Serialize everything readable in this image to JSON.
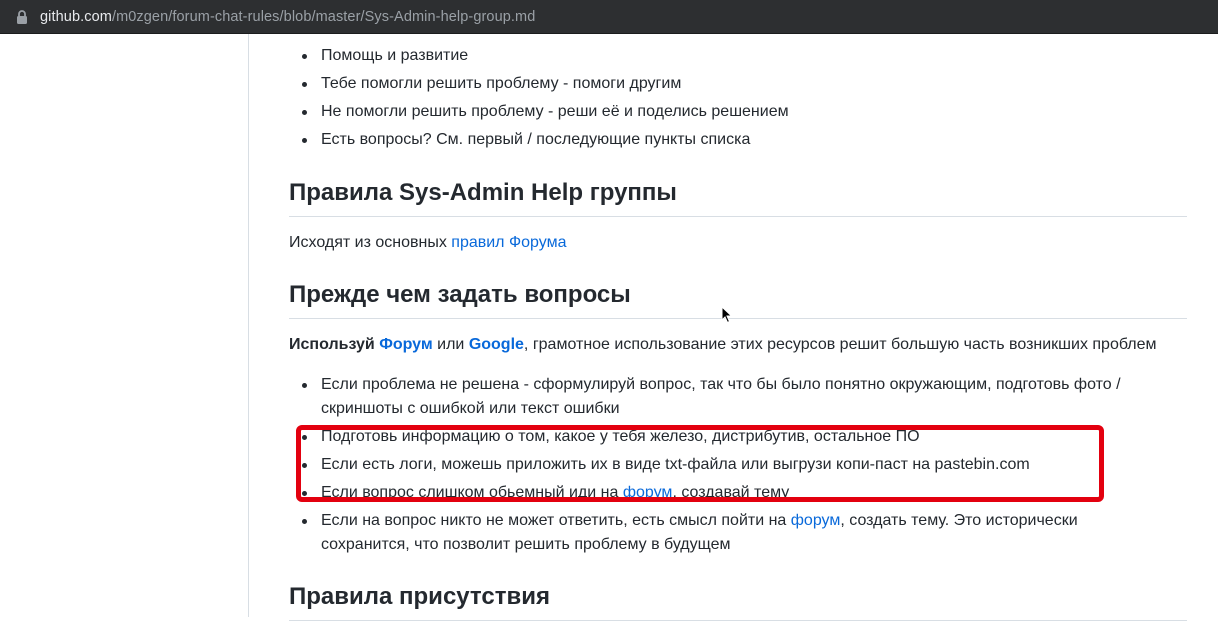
{
  "browser": {
    "url_host": "github.com",
    "url_path": "/m0zgen/forum-chat-rules/blob/master/Sys-Admin-help-group.md"
  },
  "intro_list": [
    "Помощь и развитие",
    "Тебе помогли решить проблему - помоги другим",
    "Не помогли решить проблему - реши её и поделись решением",
    "Есть вопросы? См. первый / последующие пункты списка"
  ],
  "section1": {
    "heading": "Правила Sys-Admin Help группы",
    "text_prefix": "Исходят из основных ",
    "link": "правил Форума"
  },
  "section2": {
    "heading": "Прежде чем задать вопросы",
    "lead_bold": "Используй",
    "link_forum": "Форум",
    "or_text": " или ",
    "link_google": "Google",
    "lead_rest": ", грамотное использование этих ресурсов решит большую часть возникших проблем",
    "item1_line1": "Если проблема не решена - сформулируй вопрос, так что бы было понятно окружающим, подготовь фото /",
    "item1_line2": "скриншоты с ошибкой или текст ошибки",
    "item2": "Подготовь информацию о том, какое у тебя железо, дистрибутив, остальное ПО",
    "item3": "Если есть логи, можешь приложить их в виде txt-файла или выгрузи копи-паст на pastebin.com",
    "item4_prefix": "Если вопрос слишком обьемный иди на ",
    "item4_link": "форум",
    "item4_suffix": ", создавай тему",
    "item5_prefix": "Если на вопрос никто не может ответить, есть смысл пойти на ",
    "item5_link": "форум",
    "item5_suffix": ", создать тему. Это исторически",
    "item5_line2": "сохранится, что позволит решить проблему в будущем"
  },
  "section3": {
    "heading": "Правила присутствия"
  },
  "colors": {
    "link": "#0969da",
    "highlight": "#e3000f"
  }
}
